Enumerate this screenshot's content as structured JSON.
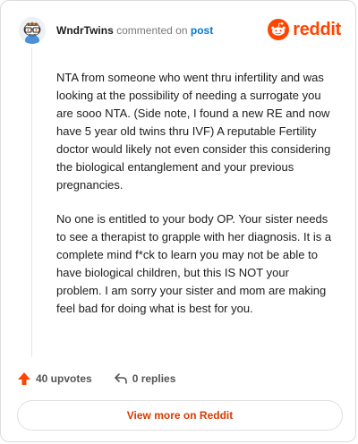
{
  "header": {
    "author": "WndrTwins",
    "action": "commented on",
    "post_link": "post"
  },
  "brand": {
    "name": "reddit",
    "color": "#ff4500",
    "icon": "reddit-alien-icon"
  },
  "comment": {
    "paragraphs": [
      "NTA from someone who went thru infertility and was looking at the possibility of needing a surrogate you are sooo NTA. (Side note, I found a new RE and now have 5 year old twins thru IVF) A reputable Fertility doctor would likely not even consider this considering the biological entanglement and your previous pregnancies.",
      "No one is entitled to your body OP. Your sister needs to see a therapist to grapple with her diagnosis. It is a complete mind f*ck to learn you may not be able to have biological children, but this IS NOT your problem. I am sorry your sister and mom are making feel bad for doing what is best for you."
    ]
  },
  "footer": {
    "upvotes": "40 upvotes",
    "replies": "0 replies",
    "upvote_icon": "upvote-arrow-icon",
    "reply_icon": "reply-arrow-icon"
  },
  "cta": {
    "label": "View more on Reddit"
  }
}
